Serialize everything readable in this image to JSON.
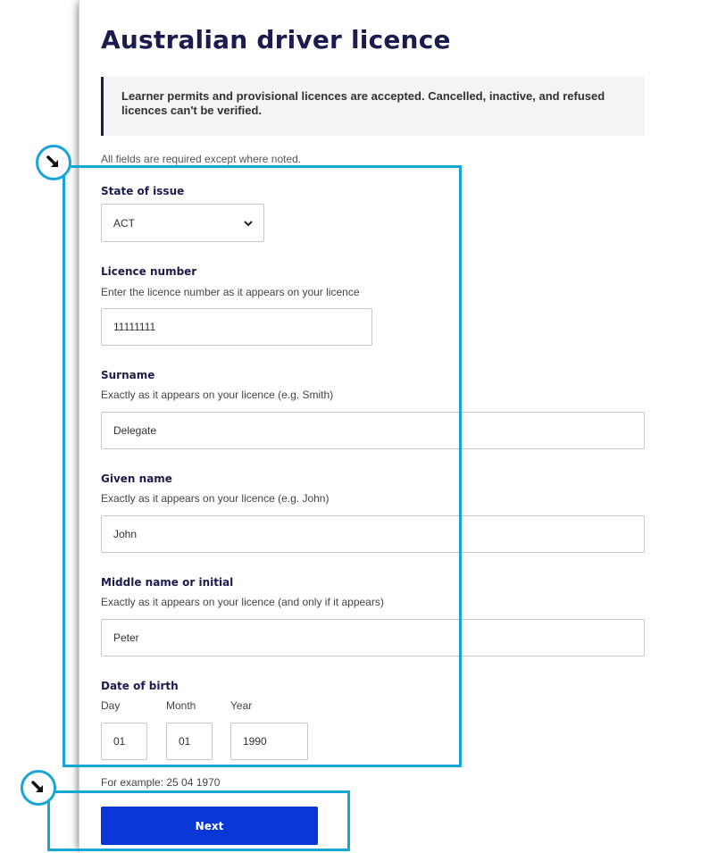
{
  "header": {
    "title": "Australian driver licence"
  },
  "callout": {
    "text": "Learner permits and provisional licences are accepted. Cancelled, inactive, and refused licences can't be verified."
  },
  "form": {
    "required_note": "All fields are required except where noted.",
    "state": {
      "label": "State of issue",
      "value": "ACT"
    },
    "licence_number": {
      "label": "Licence number",
      "hint": "Enter the licence number as it appears on your licence",
      "value": "11111111"
    },
    "surname": {
      "label": "Surname",
      "hint": "Exactly as it appears on your licence (e.g. Smith)",
      "value": "Delegate"
    },
    "given_name": {
      "label": "Given name",
      "hint": "Exactly as it appears on your licence (e.g. John)",
      "value": "John"
    },
    "middle_name": {
      "label": "Middle name or initial",
      "hint": "Exactly as it appears on your licence (and only if it appears)",
      "value": "Peter"
    },
    "dob": {
      "label": "Date of birth",
      "day_label": "Day",
      "month_label": "Month",
      "year_label": "Year",
      "day": "01",
      "month": "01",
      "year": "1990",
      "example": "For example: 25 04 1970"
    },
    "next_label": "Next"
  },
  "icons": {
    "marker": "arrow-down-right-icon",
    "select": "chevron-down-icon"
  },
  "colors": {
    "title": "#1b1b4d",
    "button": "#0a36d6",
    "highlight": "#18a6d8",
    "callout_bg": "#f3f4f6"
  }
}
